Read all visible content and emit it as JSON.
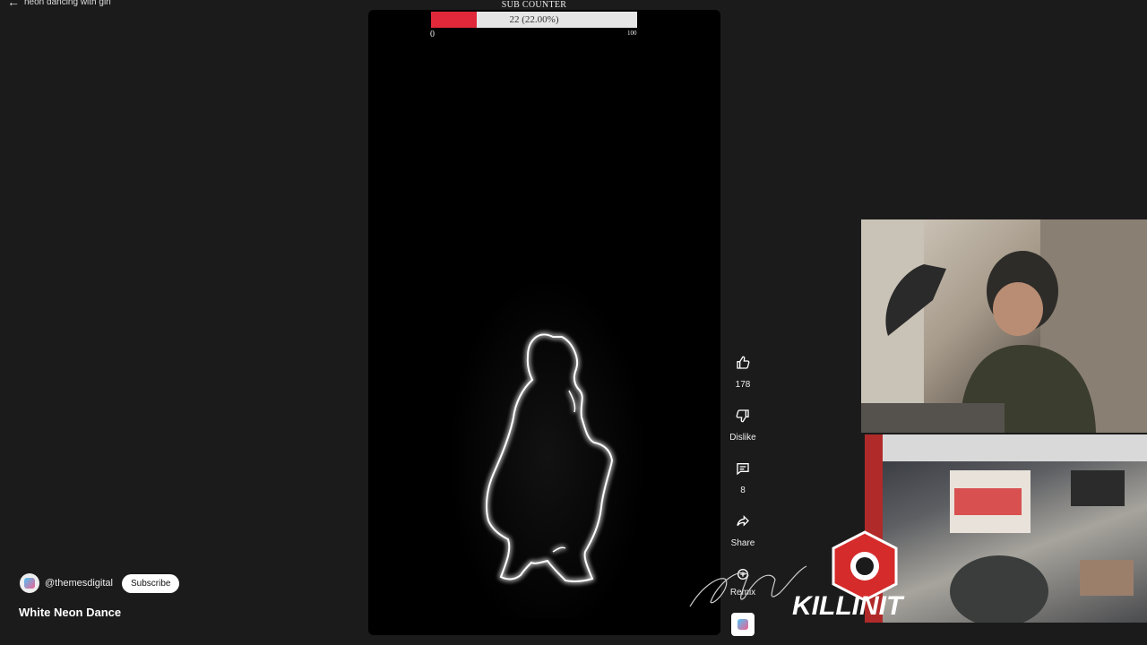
{
  "topbar": {
    "search_text": "neon dancing with girl"
  },
  "subcounter": {
    "title": "SUB COUNTER",
    "value_text": "22 (22.00%)",
    "value": 22,
    "min": "0",
    "max": "100",
    "fill_color": "#e0283a"
  },
  "video": {
    "background": "#000000"
  },
  "actions": {
    "like_count": "178",
    "dislike_label": "Dislike",
    "comment_count": "8",
    "share_label": "Share",
    "remix_label": "Remix"
  },
  "channel": {
    "handle": "@themesdigital",
    "subscribe_label": "Subscribe"
  },
  "title": "White Neon Dance",
  "overlay": {
    "brand_text": "KILLINIT",
    "brand_color": "#d62b2b"
  }
}
